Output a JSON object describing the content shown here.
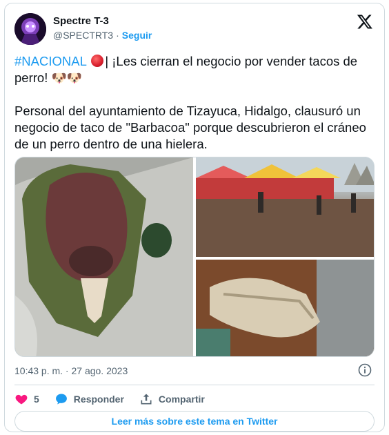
{
  "author": {
    "name": "Spectre T-3",
    "handle": "@SPECTRT3",
    "separator": "·",
    "follow_label": "Seguir"
  },
  "tweet": {
    "hashtag": "#NACIONAL",
    "line1_rest": "| ¡Les cierran el negocio por vender tacos de perro!",
    "paragraph2": "Personal del ayuntamiento de Tizayuca, Hidalgo, clausuró un negocio de taco de \"Barbacoa\" porque descubrieron el cráneo de un perro dentro de una hielera."
  },
  "icons": {
    "dog": "dog-face-icon",
    "red_circle": "red-circle-icon",
    "brand": "x-logo-icon"
  },
  "timestamp": "10:43 p. m. · 27 ago. 2023",
  "actions": {
    "like_count": "5",
    "reply_label": "Responder",
    "share_label": "Compartir"
  },
  "read_more_label": "Leer más sobre este tema en Twitter",
  "colors": {
    "accent": "#1d9bf0",
    "like": "#f91880",
    "text": "#0f1419",
    "muted": "#536471",
    "border": "#cfd9de"
  }
}
